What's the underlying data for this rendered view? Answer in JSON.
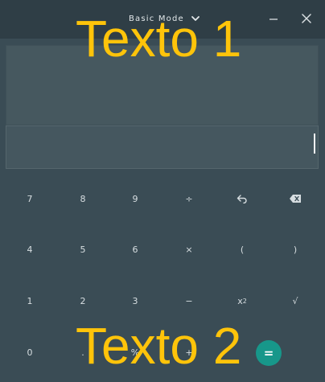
{
  "titlebar": {
    "mode_label": "Basic Mode"
  },
  "display": {
    "history": "",
    "entry": ""
  },
  "keypad": {
    "row1": [
      "7",
      "8",
      "9",
      "÷"
    ],
    "row2": [
      "4",
      "5",
      "6",
      "×",
      "(",
      ")"
    ],
    "row3": [
      "1",
      "2",
      "3",
      "−",
      "√"
    ],
    "row4": [
      "0",
      ".",
      "%",
      "+"
    ],
    "square_base": "x",
    "square_exp": "2",
    "equals": "="
  },
  "overlays": {
    "text1": "Texto 1",
    "text2": "Texto 2"
  },
  "colors": {
    "background": "#3a4c55",
    "titlebar": "#2f3e46",
    "accent_equals": "#17978a",
    "overlay_text": "#ffc40a"
  },
  "icons": {
    "chevron": "chevron-down-icon",
    "minimize": "minimize-icon",
    "close": "close-icon",
    "undo": "undo-icon",
    "backspace": "backspace-icon"
  }
}
